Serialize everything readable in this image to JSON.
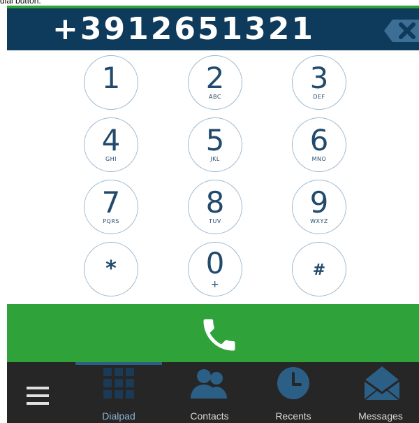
{
  "caption": {
    "text": "dial button."
  },
  "display": {
    "number": "+3912651321"
  },
  "keypad": {
    "keys": [
      {
        "digit": "1",
        "letters": ""
      },
      {
        "digit": "2",
        "letters": "ABC"
      },
      {
        "digit": "3",
        "letters": "DEF"
      },
      {
        "digit": "4",
        "letters": "GHI"
      },
      {
        "digit": "5",
        "letters": "JKL"
      },
      {
        "digit": "6",
        "letters": "MNO"
      },
      {
        "digit": "7",
        "letters": "PQRS"
      },
      {
        "digit": "8",
        "letters": "TUV"
      },
      {
        "digit": "9",
        "letters": "WXYZ"
      },
      {
        "digit": "*",
        "letters": ""
      },
      {
        "digit": "0",
        "letters": "+"
      },
      {
        "digit": "#",
        "letters": ""
      }
    ]
  },
  "nav": {
    "items": [
      {
        "label": "",
        "icon": "menu-icon"
      },
      {
        "label": "Dialpad",
        "icon": "dialpad-grid-icon",
        "active": true
      },
      {
        "label": "Contacts",
        "icon": "contacts-icon"
      },
      {
        "label": "Recents",
        "icon": "clock-icon"
      },
      {
        "label": "Messages",
        "icon": "envelope-icon"
      }
    ]
  },
  "colors": {
    "header_bg": "#0e3a5c",
    "call_green": "#2fa33a",
    "key_text": "#214a6d",
    "nav_bg": "#262626",
    "nav_icon": "#2c5f86"
  }
}
